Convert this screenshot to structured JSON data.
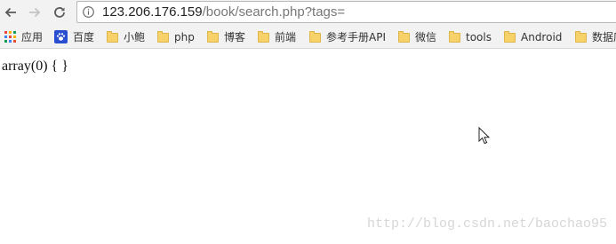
{
  "toolbar": {
    "url_host": "123.206.176.159",
    "url_path": "/book/search.php?tags="
  },
  "bookmarks": [
    {
      "label": "应用",
      "icon": "apps-grid-icon"
    },
    {
      "label": "百度",
      "icon": "baidu-paw-icon"
    },
    {
      "label": "小鲍",
      "icon": "folder-icon"
    },
    {
      "label": "php",
      "icon": "folder-icon"
    },
    {
      "label": "博客",
      "icon": "folder-icon"
    },
    {
      "label": "前端",
      "icon": "folder-icon"
    },
    {
      "label": "参考手册API",
      "icon": "folder-icon"
    },
    {
      "label": "微信",
      "icon": "folder-icon"
    },
    {
      "label": "tools",
      "icon": "folder-icon"
    },
    {
      "label": "Android",
      "icon": "folder-icon"
    },
    {
      "label": "数据库",
      "icon": "folder-icon"
    }
  ],
  "content": {
    "output": "array(0) { }"
  },
  "watermark": "http://blog.csdn.net/baochao95",
  "colors": {
    "chrome_bg": "#f2f2f2",
    "folder": "#f7d26b",
    "baidu_blue": "#2a4ed0"
  }
}
